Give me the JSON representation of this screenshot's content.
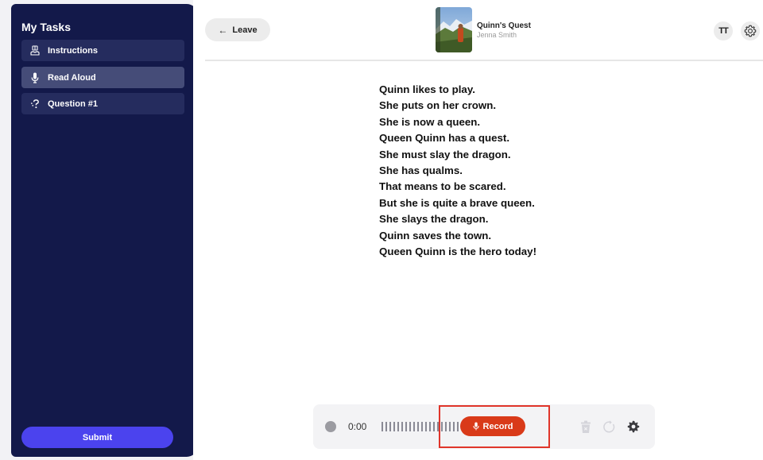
{
  "sidebar": {
    "title": "My Tasks",
    "items": [
      {
        "label": "Instructions",
        "icon": "book-hand-icon",
        "active": false
      },
      {
        "label": "Read Aloud",
        "icon": "microphone-icon",
        "active": true
      },
      {
        "label": "Question #1",
        "icon": "question-icon",
        "active": false
      }
    ],
    "submit_label": "Submit"
  },
  "header": {
    "leave_label": "Leave",
    "book_title": "Quinn's Quest",
    "book_author": "Jenna Smith",
    "text_size_label": "TT"
  },
  "story": {
    "lines": [
      "Quinn likes to play.",
      "She puts on her crown.",
      "She is now a queen.",
      "Queen Quinn has a quest.",
      "She must slay the dragon.",
      "She has qualms.",
      "That means to be scared.",
      "But she is quite a brave queen.",
      "She slays the dragon.",
      "Quinn saves the town.",
      "Queen Quinn is the hero today!"
    ]
  },
  "recorder": {
    "time": "0:00",
    "record_label": "Record"
  },
  "colors": {
    "sidebar_bg": "#13194a",
    "submit": "#4b43ee",
    "record": "#d93a19",
    "highlight": "#e0352a"
  }
}
